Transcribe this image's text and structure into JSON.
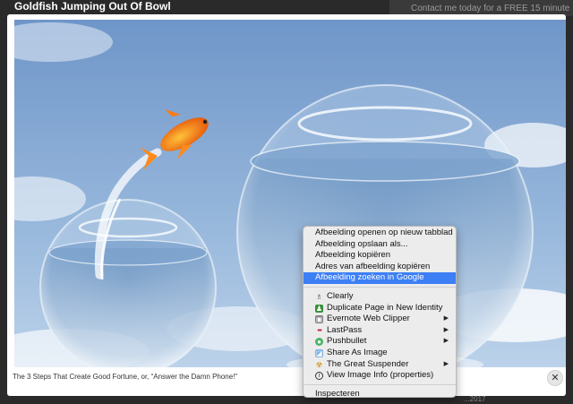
{
  "lightbox": {
    "title": "Goldfish Jumping Out Of Bowl",
    "caption": "The 3 Steps That Create Good Fortune, or, “Answer the Damn Phone!”",
    "close_label": "✕"
  },
  "background_page": {
    "banner_text": "Contact me today for a FREE 15 minute",
    "bottom_text": "...2017"
  },
  "context_menu": {
    "group1": [
      {
        "label": "Afbeelding openen op nieuw tabblad",
        "highlighted": false
      },
      {
        "label": "Afbeelding opslaan als...",
        "highlighted": false
      },
      {
        "label": "Afbeelding kopiëren",
        "highlighted": false
      },
      {
        "label": "Adres van afbeelding kopiëren",
        "highlighted": false
      },
      {
        "label": "Afbeelding zoeken in Google",
        "highlighted": true
      }
    ],
    "extensions": [
      {
        "label": "Clearly",
        "icon": "clearly-icon",
        "submenu": false
      },
      {
        "label": "Duplicate Page in New Identity",
        "icon": "identity-icon",
        "submenu": false
      },
      {
        "label": "Evernote Web Clipper",
        "icon": "evernote-icon",
        "submenu": true
      },
      {
        "label": "LastPass",
        "icon": "lastpass-icon",
        "submenu": true
      },
      {
        "label": "Pushbullet",
        "icon": "pushbullet-icon",
        "submenu": true
      },
      {
        "label": "Share As Image",
        "icon": "share-image-icon",
        "submenu": false
      },
      {
        "label": "The Great Suspender",
        "icon": "suspender-icon",
        "submenu": true
      },
      {
        "label": "View Image Info (properties)",
        "icon": "info-icon",
        "submenu": false
      }
    ],
    "inspect": "Inspecteren",
    "highlight_color": "#3d7ff5"
  }
}
